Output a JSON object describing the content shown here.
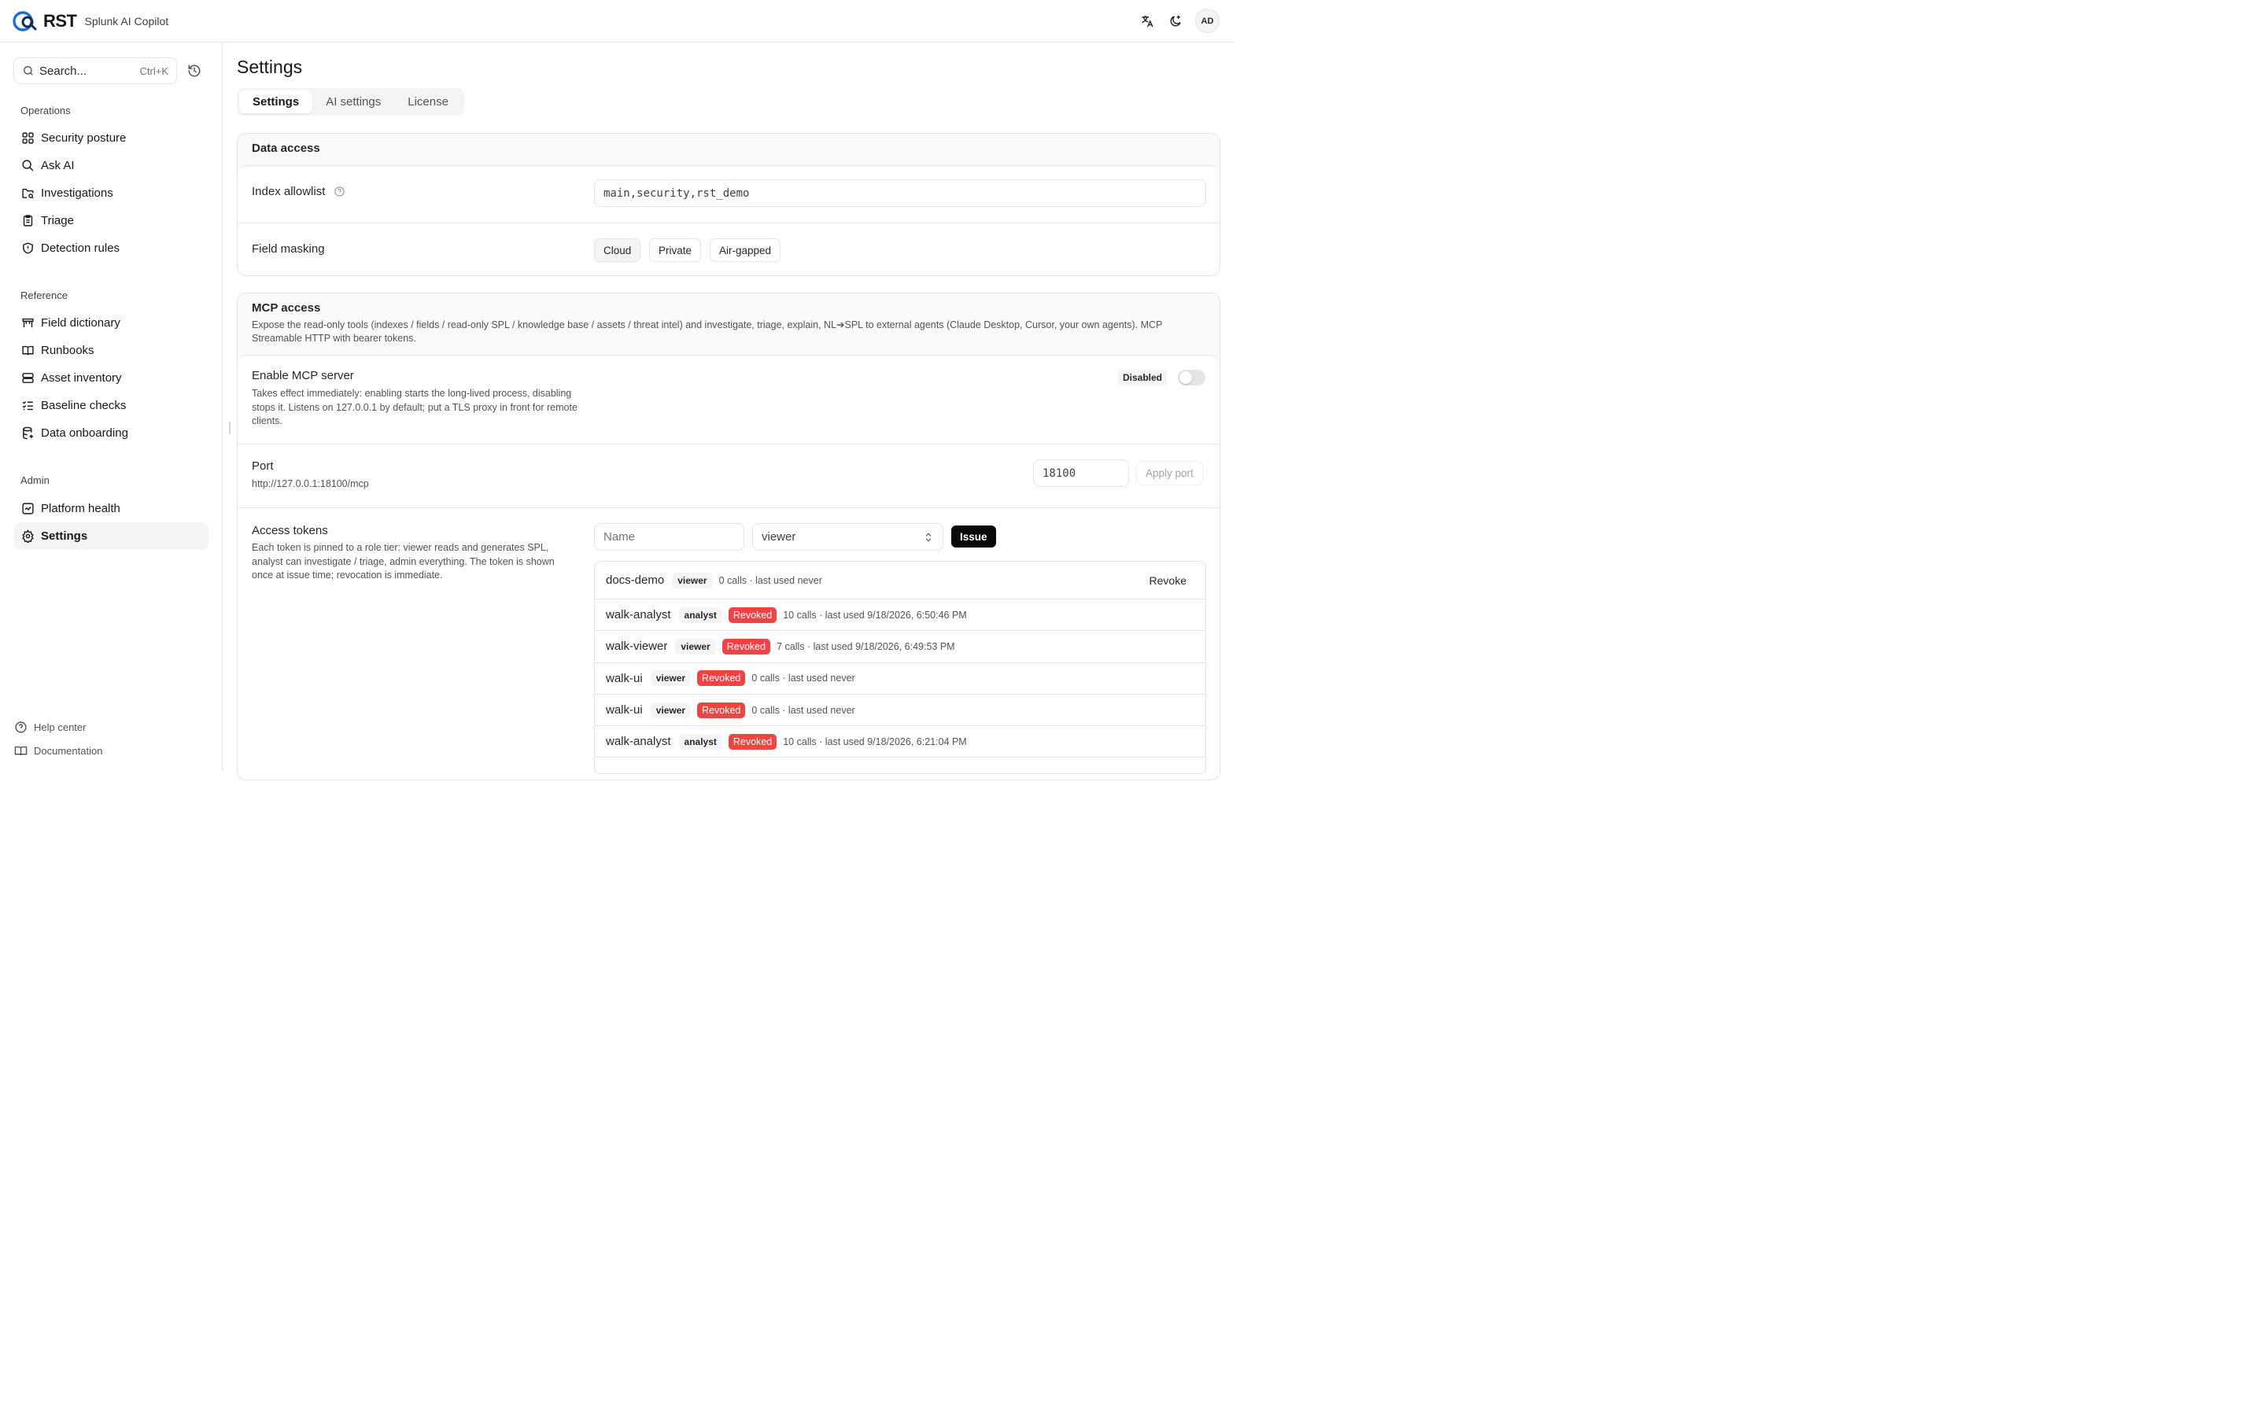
{
  "header": {
    "logo_text": "RST",
    "app_name": "Splunk AI Copilot",
    "icons": [
      "translate-icon",
      "theme-toggle-icon"
    ],
    "avatar_initials": "AD"
  },
  "sidebar": {
    "search": {
      "label": "Search...",
      "shortcut": "Ctrl+K"
    },
    "sections": [
      {
        "title": "Operations",
        "items": [
          {
            "label": "Security posture",
            "icon": "grid-icon"
          },
          {
            "label": "Ask AI",
            "icon": "search-icon"
          },
          {
            "label": "Investigations",
            "icon": "folder-search-icon"
          },
          {
            "label": "Triage",
            "icon": "clipboard-icon"
          },
          {
            "label": "Detection rules",
            "icon": "shield-alert-icon"
          }
        ]
      },
      {
        "title": "Reference",
        "items": [
          {
            "label": "Field dictionary",
            "icon": "table-icon"
          },
          {
            "label": "Runbooks",
            "icon": "book-icon"
          },
          {
            "label": "Asset inventory",
            "icon": "server-icon"
          },
          {
            "label": "Baseline checks",
            "icon": "list-checks-icon"
          },
          {
            "label": "Data onboarding",
            "icon": "database-icon"
          }
        ]
      },
      {
        "title": "Admin",
        "items": [
          {
            "label": "Platform health",
            "icon": "activity-icon"
          },
          {
            "label": "Settings",
            "icon": "gear-icon",
            "active": true
          }
        ]
      }
    ],
    "footer": [
      {
        "label": "Help center",
        "icon": "help-circle-icon"
      },
      {
        "label": "Documentation",
        "icon": "book-open-icon"
      }
    ]
  },
  "main": {
    "title": "Settings",
    "tabs": [
      {
        "label": "Settings",
        "active": true
      },
      {
        "label": "AI settings"
      },
      {
        "label": "License"
      }
    ],
    "data_access": {
      "title": "Data access",
      "index_allowlist": {
        "label": "Index allowlist",
        "value": "main,security,rst_demo"
      },
      "field_masking": {
        "label": "Field masking",
        "options": [
          "Cloud",
          "Private",
          "Air-gapped"
        ],
        "selected": "Cloud"
      }
    },
    "mcp": {
      "title": "MCP access",
      "description": "Expose the read-only tools (indexes / fields / read-only SPL / knowledge base / assets / threat intel) and investigate, triage, explain, NL➔SPL to external agents (Claude Desktop, Cursor, your own agents). MCP Streamable HTTP with bearer tokens.",
      "enable": {
        "label": "Enable MCP server",
        "description": "Takes effect immediately: enabling starts the long-lived process, disabling stops it. Listens on 127.0.0.1 by default; put a TLS proxy in front for remote clients.",
        "status": "Disabled",
        "enabled": false
      },
      "port": {
        "label": "Port",
        "url": "http://127.0.0.1:18100/mcp",
        "value": "18100",
        "apply_label": "Apply port"
      },
      "tokens": {
        "label": "Access tokens",
        "description": "Each token is pinned to a role tier: viewer reads and generates SPL, analyst can investigate / triage, admin everything. The token is shown once at issue time; revocation is immediate.",
        "name_placeholder": "Name",
        "role_value": "viewer",
        "issue_label": "Issue",
        "revoke_label": "Revoke",
        "revoked_label": "Revoked",
        "items": [
          {
            "name": "docs-demo",
            "role": "viewer",
            "revoked": false,
            "meta": "0 calls · last used never"
          },
          {
            "name": "walk-analyst",
            "role": "analyst",
            "revoked": true,
            "meta": "10 calls · last used 9/18/2026, 6:50:46 PM"
          },
          {
            "name": "walk-viewer",
            "role": "viewer",
            "revoked": true,
            "meta": "7 calls · last used 9/18/2026, 6:49:53 PM"
          },
          {
            "name": "walk-ui",
            "role": "viewer",
            "revoked": true,
            "meta": "0 calls · last used never"
          },
          {
            "name": "walk-ui",
            "role": "viewer",
            "revoked": true,
            "meta": "0 calls · last used never"
          },
          {
            "name": "walk-analyst",
            "role": "analyst",
            "revoked": true,
            "meta": "10 calls · last used 9/18/2026, 6:21:04 PM"
          }
        ]
      }
    }
  },
  "colors": {
    "accent": "#1d6fd8",
    "revoked": "#ef4444",
    "issue_button": "#09090b"
  }
}
